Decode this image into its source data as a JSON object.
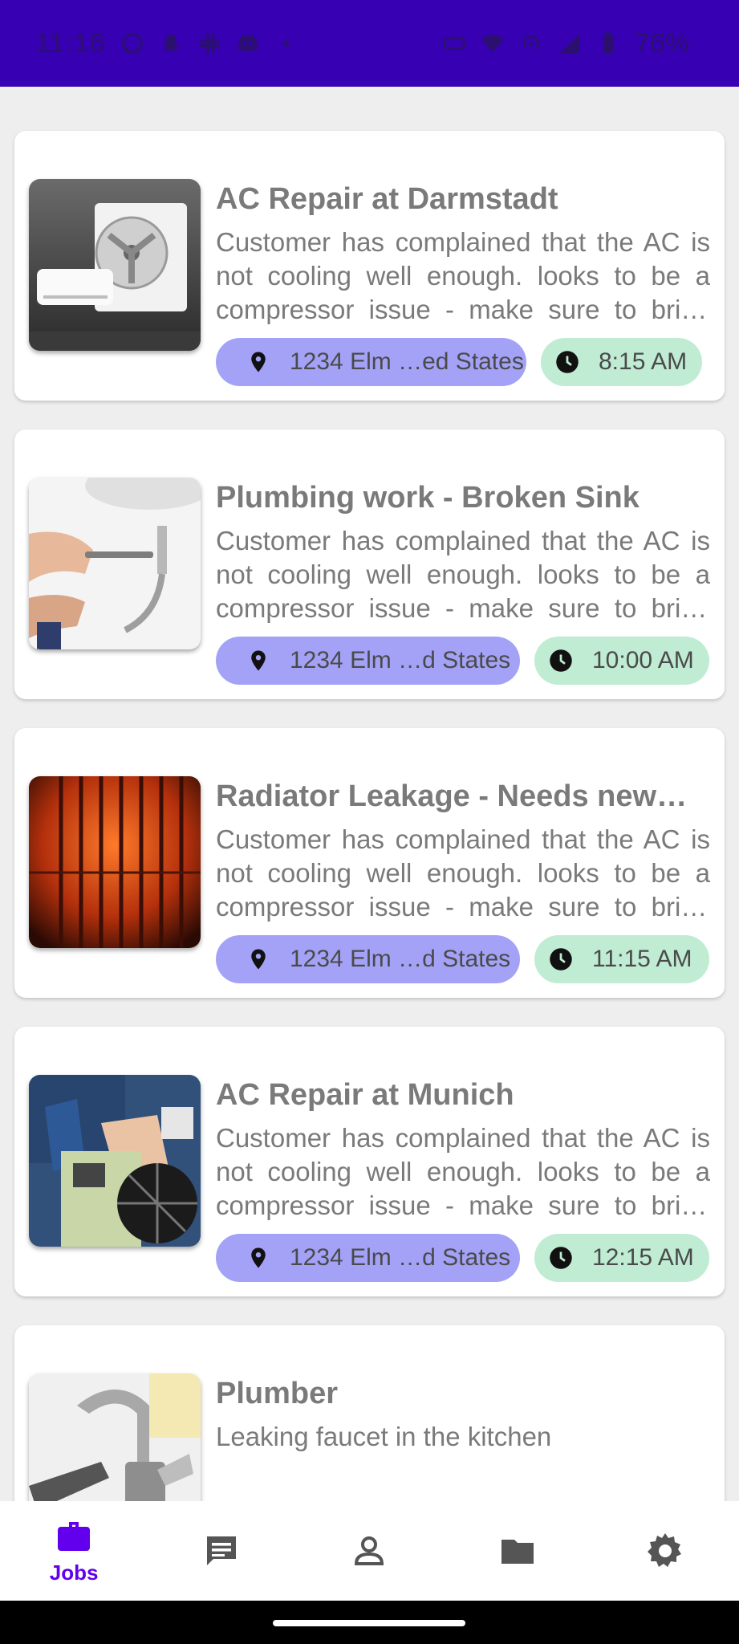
{
  "status_bar": {
    "time": "11:16",
    "battery": "76%",
    "icons": [
      "whatsapp-icon",
      "snapchat-icon",
      "slack-icon",
      "discord-icon",
      "dot-icon",
      "vr-icon",
      "wifi-icon",
      "hotspot-icon",
      "signal-icon",
      "battery-icon"
    ]
  },
  "jobs": [
    {
      "title": "AC Repair at Darmstadt",
      "description": "Customer has complained that the AC is not cooling well enough. looks to be a compressor issue - make sure to bring spare parts",
      "location": "1234 Elm …ed States",
      "time": "8:15 AM",
      "image": "ac-unit-image"
    },
    {
      "title": "Plumbing work - Broken Sink",
      "description": "Customer has complained that the AC is not cooling well enough. looks to be a compressor issue - make sure to bring spare parts",
      "location": "1234 Elm …d States",
      "time": "10:00 AM",
      "image": "plumbing-image"
    },
    {
      "title": "Radiator Leakage - Needs new…",
      "description": "Customer has complained that the AC is not cooling well enough. looks to be a compressor issue - make sure to bring spare parts",
      "location": "1234 Elm …d States",
      "time": "11:15 AM",
      "image": "radiator-image"
    },
    {
      "title": "AC Repair at Munich",
      "description": "Customer has complained that the AC is not cooling well enough. looks to be a compressor issue - make sure to bring spare parts",
      "location": "1234 Elm …d States",
      "time": "12:15 AM",
      "image": "technician-image"
    },
    {
      "title": "Plumber",
      "description": "Leaking faucet in the kitchen",
      "image": "faucet-image"
    }
  ],
  "bottom_nav": {
    "items": [
      {
        "label": "Jobs",
        "icon": "briefcase-icon",
        "active": true
      },
      {
        "label": "",
        "icon": "chat-icon",
        "active": false
      },
      {
        "label": "",
        "icon": "person-icon",
        "active": false
      },
      {
        "label": "",
        "icon": "folder-icon",
        "active": false
      },
      {
        "label": "",
        "icon": "settings-icon",
        "active": false
      }
    ]
  },
  "colors": {
    "status_bar": "#3700b3",
    "accent": "#6200ee",
    "location_chip": "#a4a2f7",
    "time_chip": "#c0ecd4",
    "text_muted": "#7a7a7a"
  }
}
